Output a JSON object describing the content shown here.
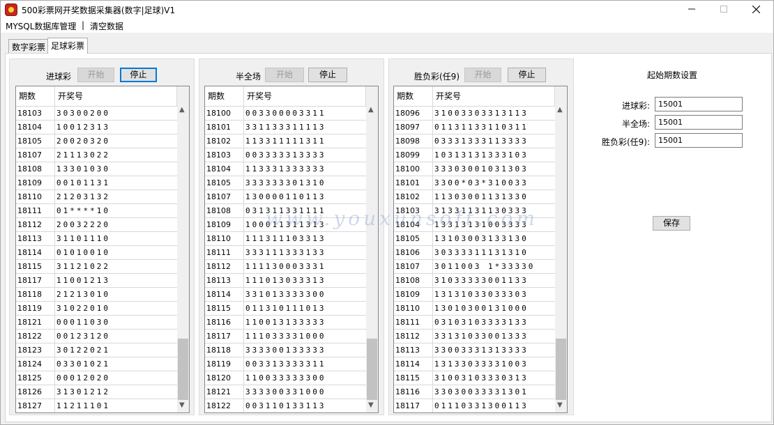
{
  "window": {
    "title": "500彩票网开奖数据采集器(数字|足球)V1",
    "min_icon": "minimize-icon",
    "max_icon": "maximize-icon",
    "close_icon": "close-icon"
  },
  "menu": {
    "mysql": "MYSQL数据库管理",
    "sep": "|",
    "clear": "清空数据"
  },
  "tabs": [
    "数字彩票",
    "足球彩票"
  ],
  "panels": [
    {
      "title": "进球彩",
      "start": "开始",
      "stop": "停止",
      "headers": [
        "期数",
        "开奖号"
      ],
      "rows": [
        [
          "18103",
          "30300200"
        ],
        [
          "18104",
          "10012313"
        ],
        [
          "18105",
          "20020320"
        ],
        [
          "18107",
          "21113022"
        ],
        [
          "18108",
          "13301030"
        ],
        [
          "18109",
          "00101131"
        ],
        [
          "18110",
          "21203132"
        ],
        [
          "18111",
          "01****10"
        ],
        [
          "18112",
          "20032220"
        ],
        [
          "18113",
          "31101110"
        ],
        [
          "18114",
          "01010010"
        ],
        [
          "18115",
          "31121022"
        ],
        [
          "18117",
          "11001213"
        ],
        [
          "18118",
          "21213010"
        ],
        [
          "18119",
          "31022010"
        ],
        [
          "18121",
          "00011030"
        ],
        [
          "18122",
          "00123120"
        ],
        [
          "18123",
          "30122021"
        ],
        [
          "18124",
          "03301021"
        ],
        [
          "18125",
          "00012020"
        ],
        [
          "18126",
          "31301212"
        ],
        [
          "18127",
          "11211101"
        ]
      ]
    },
    {
      "title": "半全场",
      "start": "开始",
      "stop": "停止",
      "headers": [
        "期数",
        "开奖号"
      ],
      "rows": [
        [
          "18100",
          "003300003311"
        ],
        [
          "18101",
          "331133311113"
        ],
        [
          "18102",
          "113311111311"
        ],
        [
          "18103",
          "003333313333"
        ],
        [
          "18104",
          "113331333333"
        ],
        [
          "18105",
          "333333301310"
        ],
        [
          "18107",
          "130000110113"
        ],
        [
          "18108",
          "031311331111"
        ],
        [
          "18109",
          "100011311313"
        ],
        [
          "18110",
          "111311103313"
        ],
        [
          "18111",
          "333111333133"
        ],
        [
          "18112",
          "111130003331"
        ],
        [
          "18113",
          "111013033313"
        ],
        [
          "18114",
          "331013333300"
        ],
        [
          "18115",
          "011310111013"
        ],
        [
          "18116",
          "110013133333"
        ],
        [
          "18117",
          "111033331000"
        ],
        [
          "18118",
          "333300133333"
        ],
        [
          "18119",
          "003313333311"
        ],
        [
          "18120",
          "110033333300"
        ],
        [
          "18121",
          "333300331000"
        ],
        [
          "18122",
          "003110133113"
        ]
      ]
    },
    {
      "title": "胜负彩(任9)",
      "start": "开始",
      "stop": "停止",
      "headers": [
        "期数",
        "开奖号"
      ],
      "rows": [
        [
          "18096",
          "31003303313113"
        ],
        [
          "18097",
          "01131133110311"
        ],
        [
          "18098",
          "03331333113333"
        ],
        [
          "18099",
          "10313131333103"
        ],
        [
          "18100",
          "33303001031303"
        ],
        [
          "18101",
          "3300*03*310033"
        ],
        [
          "18102",
          "11303001131330"
        ],
        [
          "18103",
          "31331131130333"
        ],
        [
          "18104",
          "13313131003333"
        ],
        [
          "18105",
          "13103003133130"
        ],
        [
          "18106",
          "30333311131310"
        ],
        [
          "18107",
          "3011003 1*33330"
        ],
        [
          "18108",
          "31033333001133"
        ],
        [
          "18109",
          "13131033033303"
        ],
        [
          "18110",
          "13010300131000"
        ],
        [
          "18111",
          "03103103333133"
        ],
        [
          "18112",
          "33131033001333"
        ],
        [
          "18113",
          "33003331313333"
        ],
        [
          "18114",
          "13133033331003"
        ],
        [
          "18115",
          "31003103330313"
        ],
        [
          "18116",
          "33030033331301"
        ],
        [
          "18117",
          "01110331300113"
        ]
      ]
    }
  ],
  "settings": {
    "title": "起始期数设置",
    "fields": [
      {
        "label": "进球彩:",
        "value": "15001"
      },
      {
        "label": "半全场:",
        "value": "15001"
      },
      {
        "label": "胜负彩(任9):",
        "value": "15001"
      }
    ],
    "save": "保存"
  },
  "watermark": "www.youxunsoft.com"
}
